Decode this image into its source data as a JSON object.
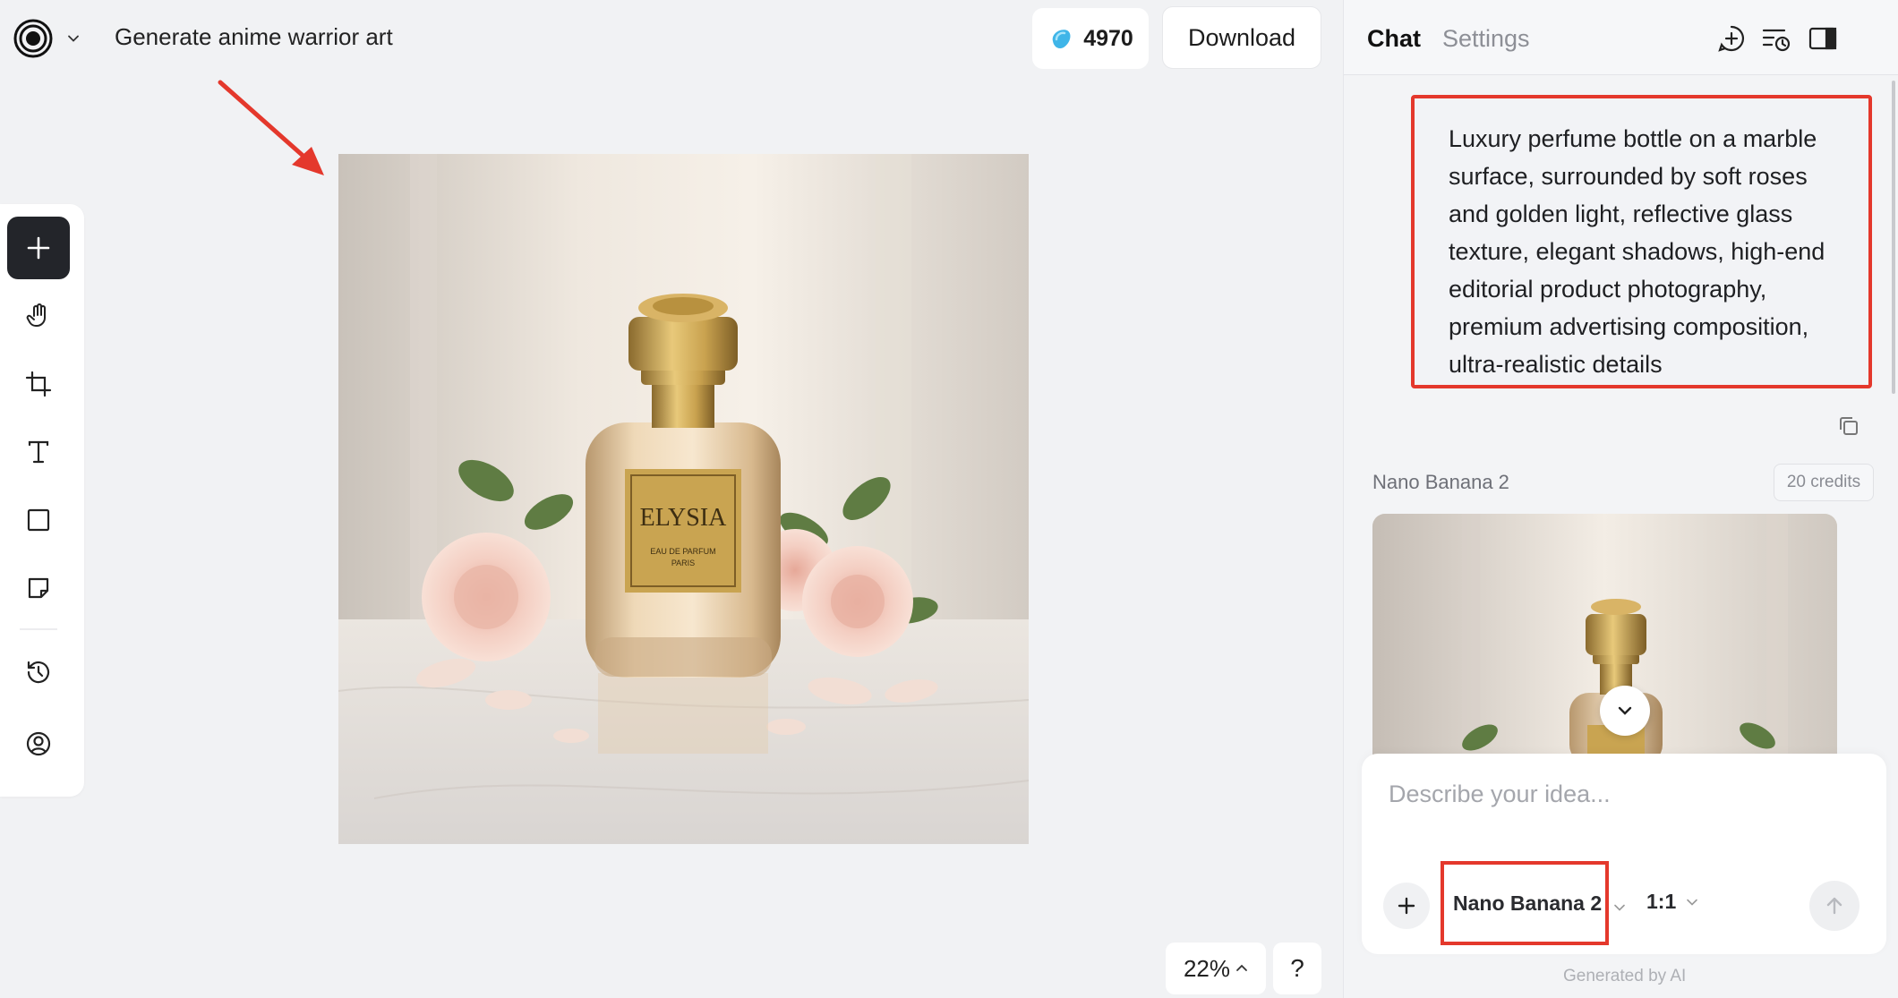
{
  "header": {
    "doc_title": "Generate anime warrior art",
    "credits": "4970",
    "download_label": "Download"
  },
  "canvas": {
    "label_brand": "ELYSIA",
    "label_sub1": "EAU DE PARFUM",
    "label_sub2": "PARIS"
  },
  "zoom": {
    "level": "22%",
    "help_label": "?"
  },
  "panel": {
    "tab_chat": "Chat",
    "tab_settings": "Settings",
    "prompt_text": "Luxury perfume bottle on a marble surface, surrounded by soft roses and golden light, reflective glass texture, elegant shadows, high-end editorial product photography, premium advertising composition, ultra-realistic details",
    "model_name": "Nano Banana 2",
    "credits_badge": "20 credits",
    "composer_placeholder": "Describe your idea...",
    "composer_model": "Nano Banana 2",
    "composer_ratio": "1:1",
    "footer_note": "Generated by AI"
  },
  "colors": {
    "accent_red": "#e4382c",
    "toolbar_active": "#23252a",
    "gem": "#3fb5e8"
  },
  "icons": {
    "toolbar": [
      "plus-icon",
      "hand-icon",
      "crop-icon",
      "text-icon",
      "rectangle-icon",
      "sticky-note-icon",
      "history-icon",
      "user-circle-icon"
    ],
    "header": [
      "new-chat-icon",
      "chat-history-icon",
      "sidebar-toggle-icon"
    ]
  }
}
